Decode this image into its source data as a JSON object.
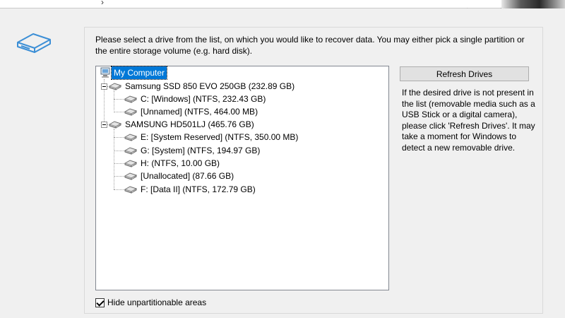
{
  "intro_text": "Please select a drive from the list, on which you would like to recover data. You may either pick a single partition or the entire storage volume (e.g. hard disk).",
  "tree": {
    "root": "My Computer",
    "disk1": "Samsung SSD 850 EVO 250GB (232.89 GB)",
    "disk1_p1": "C: [Windows] (NTFS, 232.43 GB)",
    "disk1_p2": "[Unnamed] (NTFS, 464.00 MB)",
    "disk2": "SAMSUNG HD501LJ (465.76 GB)",
    "disk2_p1": "E: [System Reserved] (NTFS, 350.00 MB)",
    "disk2_p2": "G: [System] (NTFS, 194.97 GB)",
    "disk2_p3": "H: (NTFS, 10.00 GB)",
    "disk2_p4": "[Unallocated] (87.66 GB)",
    "disk2_p5": "F: [Data II] (NTFS, 172.79 GB)"
  },
  "refresh_button": "Refresh Drives",
  "help_text": "If the desired drive is not present in the list (removable media such as a USB Stick or a digital camera), please click 'Refresh Drives'. It may take a moment for Windows to detect a new removable drive.",
  "hide_checkbox": {
    "label": "Hide unpartitionable areas",
    "checked": true
  },
  "colors": {
    "selection": "#0078d7",
    "icon_blue": "#3c8fd6"
  }
}
